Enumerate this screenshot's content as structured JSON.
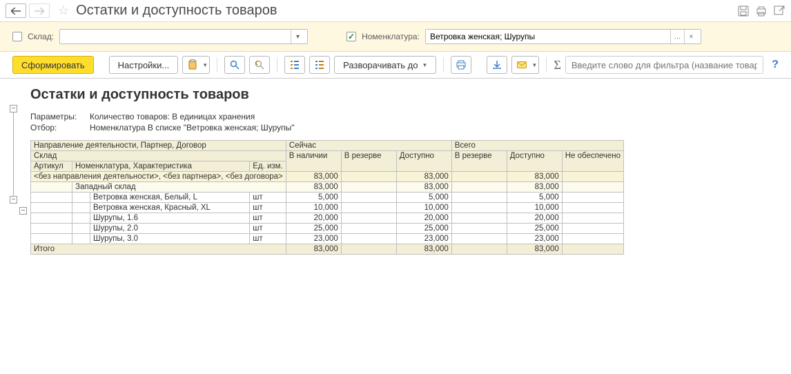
{
  "title": "Остатки и доступность товаров",
  "filters": {
    "sklad_label": "Склад:",
    "sklad_value": "",
    "nomen_label": "Номенклатура:",
    "nomen_value": "Ветровка женская; Шурупы"
  },
  "toolbar": {
    "form": "Сформировать",
    "settings": "Настройки...",
    "expand": "Разворачивать до",
    "filter_placeholder": "Введите слово для фильтра (название товар..."
  },
  "report": {
    "title": "Остатки и доступность товаров",
    "param_label": "Параметры:",
    "param_value": "Количество товаров: В единицах хранения",
    "filter_label": "Отбор:",
    "filter_value": "Номенклатура В списке \"Ветровка женская; Шурупы\"",
    "headers": {
      "dir": "Направление деятельности, Партнер, Договор",
      "sklad": "Склад",
      "art": "Артикул",
      "nomen": "Номенклатура, Характеристика",
      "uom": "Ед. изм.",
      "now": "Сейчас",
      "total": "Всего",
      "in_stock": "В наличии",
      "reserved": "В резерве",
      "available": "Доступно",
      "unfulfilled": "Не обеспечено"
    },
    "group1": "<без направления деятельности>, <без партнера>, <без договора>",
    "group2": "Западный склад",
    "items": [
      {
        "name": "Ветровка женская, Белый, L",
        "uom": "шт",
        "stock": "5,000",
        "avail": "5,000",
        "t_avail": "5,000"
      },
      {
        "name": "Ветровка женская, Красный, XL",
        "uom": "шт",
        "stock": "10,000",
        "avail": "10,000",
        "t_avail": "10,000"
      },
      {
        "name": "Шурупы, 1.6",
        "uom": "шт",
        "stock": "20,000",
        "avail": "20,000",
        "t_avail": "20,000"
      },
      {
        "name": "Шурупы, 2.0",
        "uom": "шт",
        "stock": "25,000",
        "avail": "25,000",
        "t_avail": "25,000"
      },
      {
        "name": "Шурупы, 3.0",
        "uom": "шт",
        "stock": "23,000",
        "avail": "23,000",
        "t_avail": "23,000"
      }
    ],
    "group1_vals": {
      "stock": "83,000",
      "avail": "83,000",
      "t_avail": "83,000"
    },
    "group2_vals": {
      "stock": "83,000",
      "avail": "83,000",
      "t_avail": "83,000"
    },
    "total_label": "Итого",
    "total_vals": {
      "stock": "83,000",
      "avail": "83,000",
      "t_avail": "83,000"
    }
  }
}
